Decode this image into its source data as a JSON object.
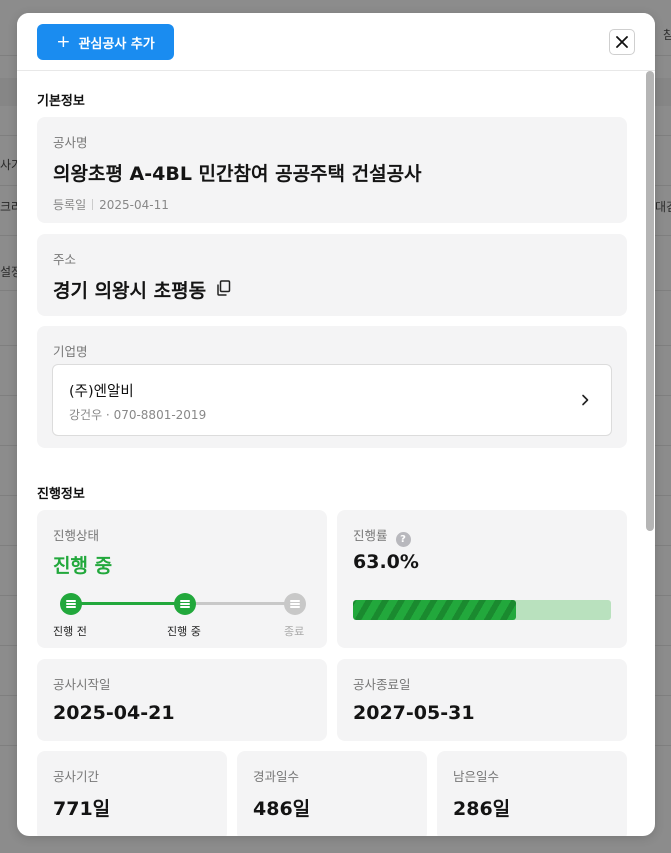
{
  "background": {
    "fragments": [
      "사가",
      "크라",
      "설정",
      "대검",
      "참"
    ]
  },
  "header": {
    "add_button_label": "관심공사 추가",
    "plus_icon": "+",
    "close_icon": "×"
  },
  "basic_info": {
    "section_title": "기본정보",
    "project_name_label": "공사명",
    "project_name": "의왕초평 A-4BL 민간참여 공공주택 건설공사",
    "registered_label": "등록일",
    "registered_date": "2025-04-11",
    "address_label": "주소",
    "address": "경기 의왕시 초평동",
    "company_label": "기업명",
    "company_name": "(주)엔알비",
    "company_contact": "강건우 · 070-8801-2019"
  },
  "progress_info": {
    "section_title": "진행정보",
    "status_label": "진행상태",
    "status_value": "진행 중",
    "steps": [
      {
        "label": "진행 전",
        "state": "done"
      },
      {
        "label": "진행 중",
        "state": "current"
      },
      {
        "label": "종료",
        "state": "pending"
      }
    ],
    "rate_label": "진행률",
    "rate_help_icon": "?",
    "rate_value": "63.0%",
    "rate_fraction": 0.63,
    "start_label": "공사시작일",
    "start_date": "2025-04-21",
    "end_label": "공사종료일",
    "end_date": "2027-05-31",
    "duration_label": "공사기간",
    "duration_value": "771일",
    "elapsed_label": "경과일수",
    "elapsed_value": "486일",
    "remaining_label": "남은일수",
    "remaining_value": "286일"
  },
  "colors": {
    "primary": "#1a8cf0",
    "progress_green": "#22a83c",
    "progress_track": "#b9e1be",
    "pending_gray": "#c8c8c8"
  }
}
